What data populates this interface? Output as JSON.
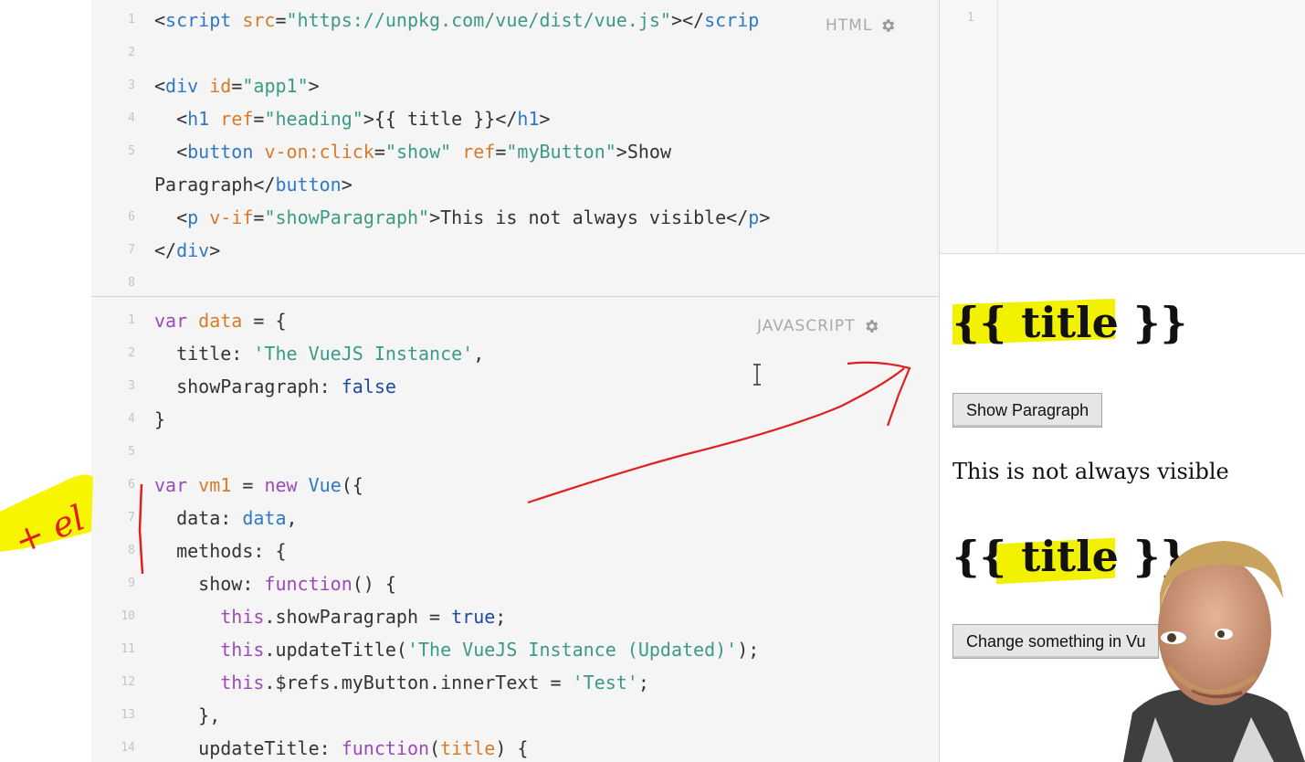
{
  "html_pane": {
    "label": "HTML",
    "lines": [
      {
        "n": "1",
        "html": "<span class='t-plain'>&lt;</span><span class='t-tag'>script</span> <span class='t-attr'>src</span><span class='t-plain'>=</span><span class='t-str'>\"https://unpkg.com/vue/dist/vue.js\"</span><span class='t-plain'>&gt;&lt;/</span><span class='t-tag'>scrip</span>"
      },
      {
        "n": "2",
        "html": ""
      },
      {
        "n": "3",
        "html": "<span class='t-plain'>&lt;</span><span class='t-tag'>div</span> <span class='t-attr'>id</span><span class='t-plain'>=</span><span class='t-str'>\"app1\"</span><span class='t-plain'>&gt;</span>"
      },
      {
        "n": "4",
        "html": "  <span class='t-plain'>&lt;</span><span class='t-tag'>h1</span> <span class='t-attr'>ref</span><span class='t-plain'>=</span><span class='t-str'>\"heading\"</span><span class='t-plain'>&gt;{{ title }}&lt;/</span><span class='t-tag'>h1</span><span class='t-plain'>&gt;</span>"
      },
      {
        "n": "5",
        "html": "  <span class='t-plain'>&lt;</span><span class='t-tag'>button</span> <span class='t-attr'>v-on:click</span><span class='t-plain'>=</span><span class='t-str'>\"show\"</span> <span class='t-attr'>ref</span><span class='t-plain'>=</span><span class='t-str'>\"myButton\"</span><span class='t-plain'>&gt;Show</span>"
      },
      {
        "n": "",
        "html": "<span class='t-plain'>Paragraph&lt;/</span><span class='t-tag'>button</span><span class='t-plain'>&gt;</span>"
      },
      {
        "n": "6",
        "html": "  <span class='t-plain'>&lt;</span><span class='t-tag'>p</span> <span class='t-attr'>v-if</span><span class='t-plain'>=</span><span class='t-str'>\"showParagraph\"</span><span class='t-plain'>&gt;This is not always visible&lt;/</span><span class='t-tag'>p</span><span class='t-plain'>&gt;</span>"
      },
      {
        "n": "7",
        "html": "<span class='t-plain'>&lt;/</span><span class='t-tag'>div</span><span class='t-plain'>&gt;</span>"
      },
      {
        "n": "8",
        "html": ""
      }
    ]
  },
  "js_pane": {
    "label": "JAVASCRIPT",
    "lines": [
      {
        "n": "1",
        "html": "<span class='t-kw'>var</span> <span class='t-var'>data</span> <span class='t-plain'>= {</span>"
      },
      {
        "n": "2",
        "html": "  <span class='t-plain'>title: </span><span class='t-str'>'The VueJS Instance'</span><span class='t-plain'>,</span>"
      },
      {
        "n": "3",
        "html": "  <span class='t-plain'>showParagraph: </span><span class='t-bool'>false</span>"
      },
      {
        "n": "4",
        "html": "<span class='t-plain'>}</span>"
      },
      {
        "n": "5",
        "html": ""
      },
      {
        "n": "6",
        "html": "<span class='t-kw'>var</span> <span class='t-var'>vm1</span> <span class='t-plain'>= </span><span class='t-kw'>new</span> <span class='t-fn'>Vue</span><span class='t-plain'>({</span>"
      },
      {
        "n": "7",
        "html": "  <span class='t-plain'>data: </span><span class='t-fn'>data</span><span class='t-plain'>,</span>"
      },
      {
        "n": "8",
        "html": "  <span class='t-plain'>methods: {</span>"
      },
      {
        "n": "9",
        "html": "    <span class='t-plain'>show: </span><span class='t-kw'>function</span><span class='t-plain'>() {</span>"
      },
      {
        "n": "10",
        "html": "      <span class='t-this'>this</span><span class='t-plain'>.showParagraph = </span><span class='t-bool'>true</span><span class='t-plain'>;</span>"
      },
      {
        "n": "11",
        "html": "      <span class='t-this'>this</span><span class='t-plain'>.updateTitle(</span><span class='t-str'>'The VueJS Instance (Updated)'</span><span class='t-plain'>);</span>"
      },
      {
        "n": "12",
        "html": "      <span class='t-this'>this</span><span class='t-plain'>.$refs.myButton.innerText = </span><span class='t-str'>'Test'</span><span class='t-plain'>;</span>"
      },
      {
        "n": "13",
        "html": "    <span class='t-plain'>},</span>"
      },
      {
        "n": "14",
        "html": "    <span class='t-plain'>updateTitle: </span><span class='t-kw'>function</span><span class='t-plain'>(</span><span class='t-param'>title</span><span class='t-plain'>) {</span>"
      }
    ]
  },
  "css_pane": {
    "line": "1"
  },
  "output": {
    "heading1": "{{ title }}",
    "button1": "Show Paragraph",
    "paragraph": "This is not always visible",
    "heading2": "{{ title }}",
    "button2": "Change something in Vu"
  },
  "annotation": {
    "note": "+ el"
  },
  "colors": {
    "highlight": "#f2f200",
    "pen": "#e02020"
  },
  "icons": [
    "gear-icon",
    "text-cursor-icon"
  ]
}
